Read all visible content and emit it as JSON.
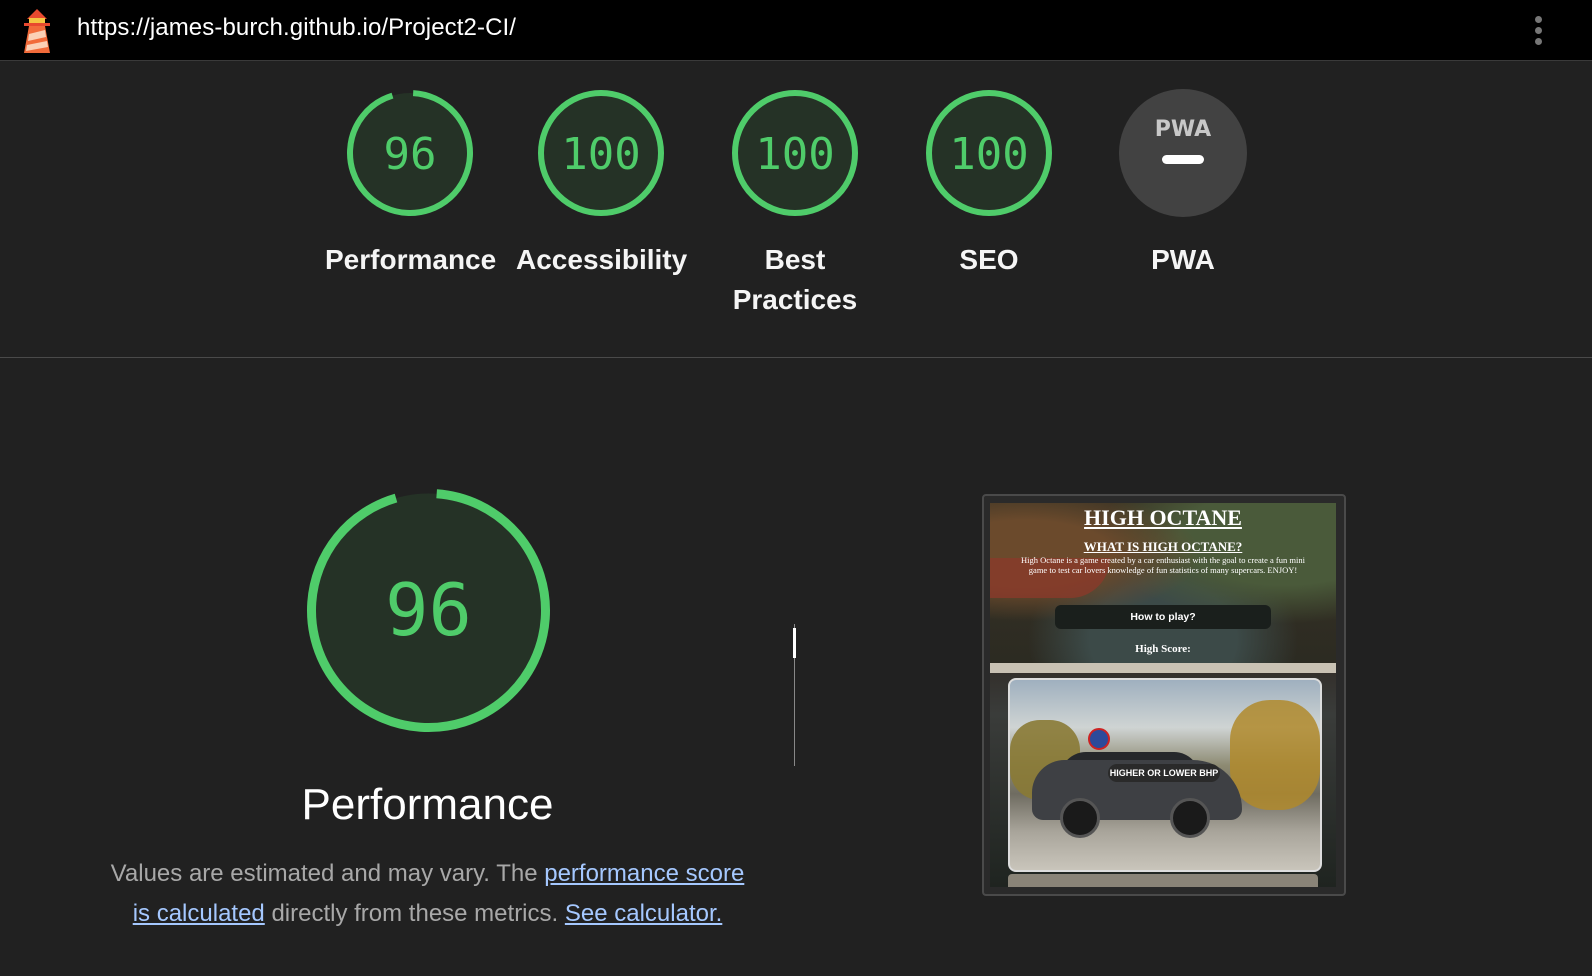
{
  "topbar": {
    "url": "https://james-burch.github.io/Project2-CI/",
    "logo_icon": "lighthouse-icon",
    "menu_icon": "kebab-menu-icon"
  },
  "gauges": [
    {
      "score": "96",
      "value": 96,
      "label": "Performance"
    },
    {
      "score": "100",
      "value": 100,
      "label": "Accessibility"
    },
    {
      "score": "100",
      "value": 100,
      "label_line1": "Best",
      "label_line2": "Practices"
    },
    {
      "score": "100",
      "value": 100,
      "label": "SEO"
    },
    {
      "badge": "PWA",
      "label": "PWA"
    }
  ],
  "colors": {
    "pass": "#4fcc6a",
    "gauge_fill": "#253226",
    "pwa_bg": "#424242",
    "link": "#a5c8ff"
  },
  "performance": {
    "score": "96",
    "value": 96,
    "title": "Performance",
    "desc_prefix": "Values are estimated and may vary. The ",
    "link_score": "performance score is calculated",
    "desc_mid": " directly from these metrics. ",
    "link_calc": "See calculator."
  },
  "screenshot": {
    "title": "HIGH OCTANE",
    "subtitle": "WHAT IS HIGH OCTANE?",
    "body": "High Octane is a game created by a car enthusiast with the goal to create a fun mini game to test car lovers knowledge of fun statistics of many supercars. ENJOY!",
    "how_to_play": "How to play?",
    "high_score": "High Score:",
    "game_button": "HIGHER OR LOWER BHP"
  }
}
